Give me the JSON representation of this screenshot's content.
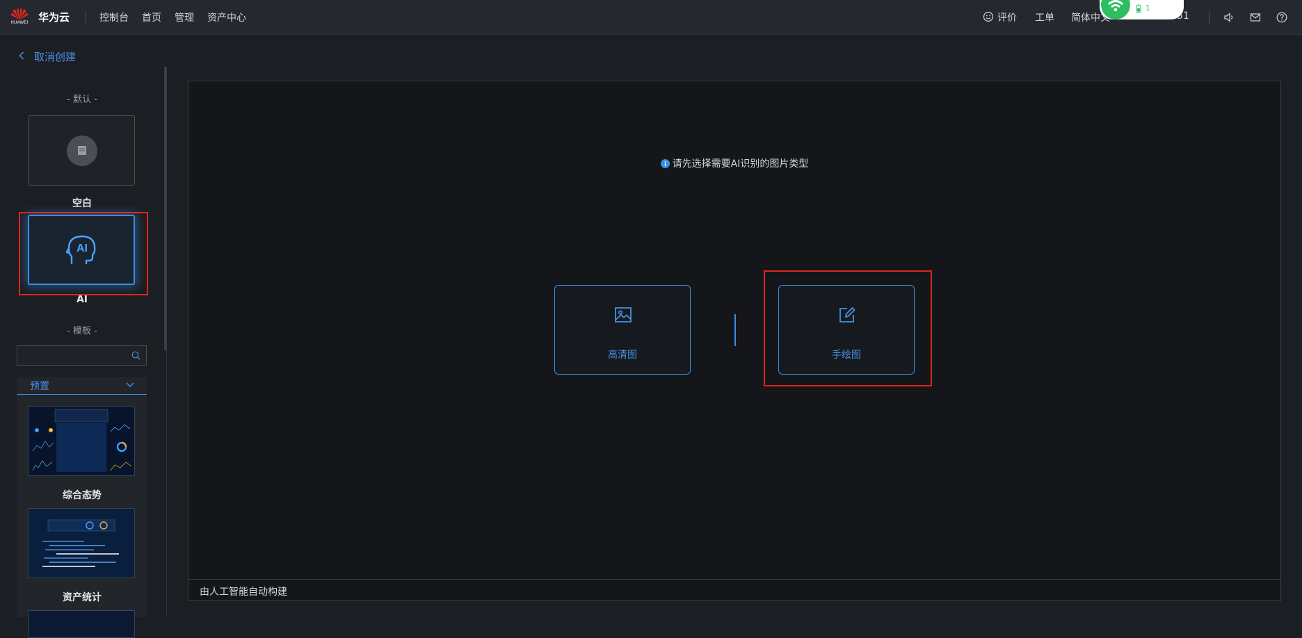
{
  "header": {
    "logo_text": "HUAWEI",
    "brand": "华为云",
    "nav": [
      "控制台",
      "首页",
      "管理",
      "资产中心"
    ],
    "feedback": "评价",
    "ticket": "工单",
    "language": "简体中文",
    "account": "51"
  },
  "popup": {
    "count": "1"
  },
  "sidebar": {
    "back_label": "取消创建",
    "default_section": "- 默认 -",
    "blank_label": "空白",
    "ai_label": "AI",
    "ai_icon_text": "AI",
    "template_section": "- 模板 -",
    "search_placeholder": "",
    "category": "预置",
    "templates": [
      "综合态势",
      "资产统计"
    ]
  },
  "main": {
    "hint": "请先选择需要AI识别的图片类型",
    "option_hd": "高清图",
    "option_sketch": "手绘图",
    "footer": "由人工智能自动构建"
  },
  "colors": {
    "accent": "#3a8ee6",
    "highlight": "#e0241f",
    "background": "#1b1e22"
  }
}
